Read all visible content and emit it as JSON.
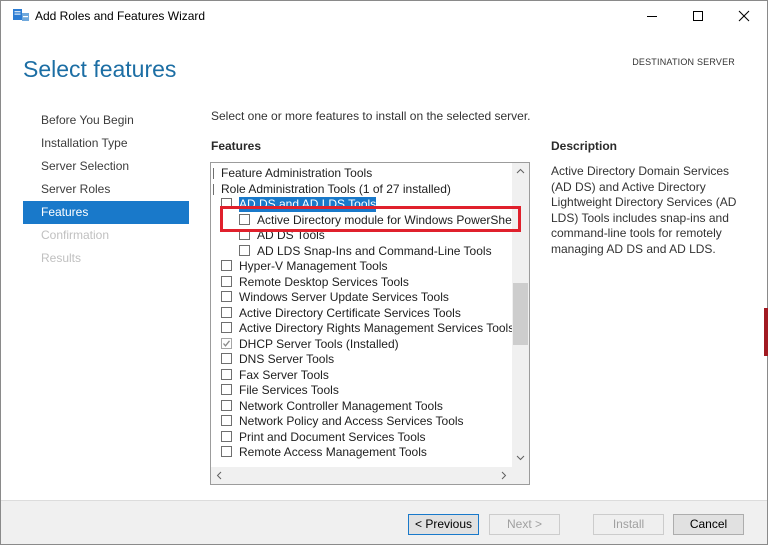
{
  "window": {
    "title": "Add Roles and Features Wizard"
  },
  "page": {
    "title": "Select features",
    "destination_label": "DESTINATION SERVER",
    "destination_value": "",
    "instruction": "Select one or more features to install on the selected server.",
    "features_heading": "Features",
    "description_heading": "Description",
    "description_text": "Active Directory Domain Services (AD DS) and Active Directory Lightweight Directory Services (AD LDS) Tools includes snap-ins and command-line tools for remotely managing AD DS and AD LDS."
  },
  "nav": {
    "items": [
      {
        "label": "Before You Begin",
        "state": "normal"
      },
      {
        "label": "Installation Type",
        "state": "normal"
      },
      {
        "label": "Server Selection",
        "state": "normal"
      },
      {
        "label": "Server Roles",
        "state": "normal"
      },
      {
        "label": "Features",
        "state": "active"
      },
      {
        "label": "Confirmation",
        "state": "disabled"
      },
      {
        "label": "Results",
        "state": "disabled"
      }
    ]
  },
  "tree": {
    "items": [
      {
        "label": "Feature Administration Tools",
        "level": 0,
        "checkbox": false,
        "checked": false,
        "selected": false
      },
      {
        "label": "Role Administration Tools (1 of 27 installed)",
        "level": 0,
        "checkbox": false,
        "checked": false,
        "selected": false
      },
      {
        "label": "AD DS and AD LDS Tools",
        "level": 1,
        "checkbox": true,
        "checked": false,
        "selected": true
      },
      {
        "label": "Active Directory module for Windows PowerShell",
        "level": 2,
        "checkbox": true,
        "checked": false,
        "selected": false
      },
      {
        "label": "AD DS Tools",
        "level": 2,
        "checkbox": true,
        "checked": false,
        "selected": false
      },
      {
        "label": "AD LDS Snap-Ins and Command-Line Tools",
        "level": 2,
        "checkbox": true,
        "checked": false,
        "selected": false
      },
      {
        "label": "Hyper-V Management Tools",
        "level": 1,
        "checkbox": true,
        "checked": false,
        "selected": false
      },
      {
        "label": "Remote Desktop Services Tools",
        "level": 1,
        "checkbox": true,
        "checked": false,
        "selected": false
      },
      {
        "label": "Windows Server Update Services Tools",
        "level": 1,
        "checkbox": true,
        "checked": false,
        "selected": false
      },
      {
        "label": "Active Directory Certificate Services Tools",
        "level": 1,
        "checkbox": true,
        "checked": false,
        "selected": false
      },
      {
        "label": "Active Directory Rights Management Services Tools",
        "level": 1,
        "checkbox": true,
        "checked": false,
        "selected": false
      },
      {
        "label": "DHCP Server Tools (Installed)",
        "level": 1,
        "checkbox": true,
        "checked": true,
        "selected": false
      },
      {
        "label": "DNS Server Tools",
        "level": 1,
        "checkbox": true,
        "checked": false,
        "selected": false
      },
      {
        "label": "Fax Server Tools",
        "level": 1,
        "checkbox": true,
        "checked": false,
        "selected": false
      },
      {
        "label": "File Services Tools",
        "level": 1,
        "checkbox": true,
        "checked": false,
        "selected": false
      },
      {
        "label": "Network Controller Management Tools",
        "level": 1,
        "checkbox": true,
        "checked": false,
        "selected": false
      },
      {
        "label": "Network Policy and Access Services Tools",
        "level": 1,
        "checkbox": true,
        "checked": false,
        "selected": false
      },
      {
        "label": "Print and Document Services Tools",
        "level": 1,
        "checkbox": true,
        "checked": false,
        "selected": false
      },
      {
        "label": "Remote Access Management Tools",
        "level": 1,
        "checkbox": true,
        "checked": false,
        "selected": false
      }
    ]
  },
  "buttons": {
    "previous": "< Previous",
    "next": "Next >",
    "install": "Install",
    "cancel": "Cancel"
  },
  "icons": {
    "app": "server-manager-icon",
    "minimize": "minimize-icon",
    "maximize": "maximize-icon",
    "close": "close-icon",
    "checkmark": "checkmark-icon"
  },
  "colors": {
    "accent": "#1979ca",
    "title": "#1c6ea4",
    "highlight": "#e0202c"
  }
}
